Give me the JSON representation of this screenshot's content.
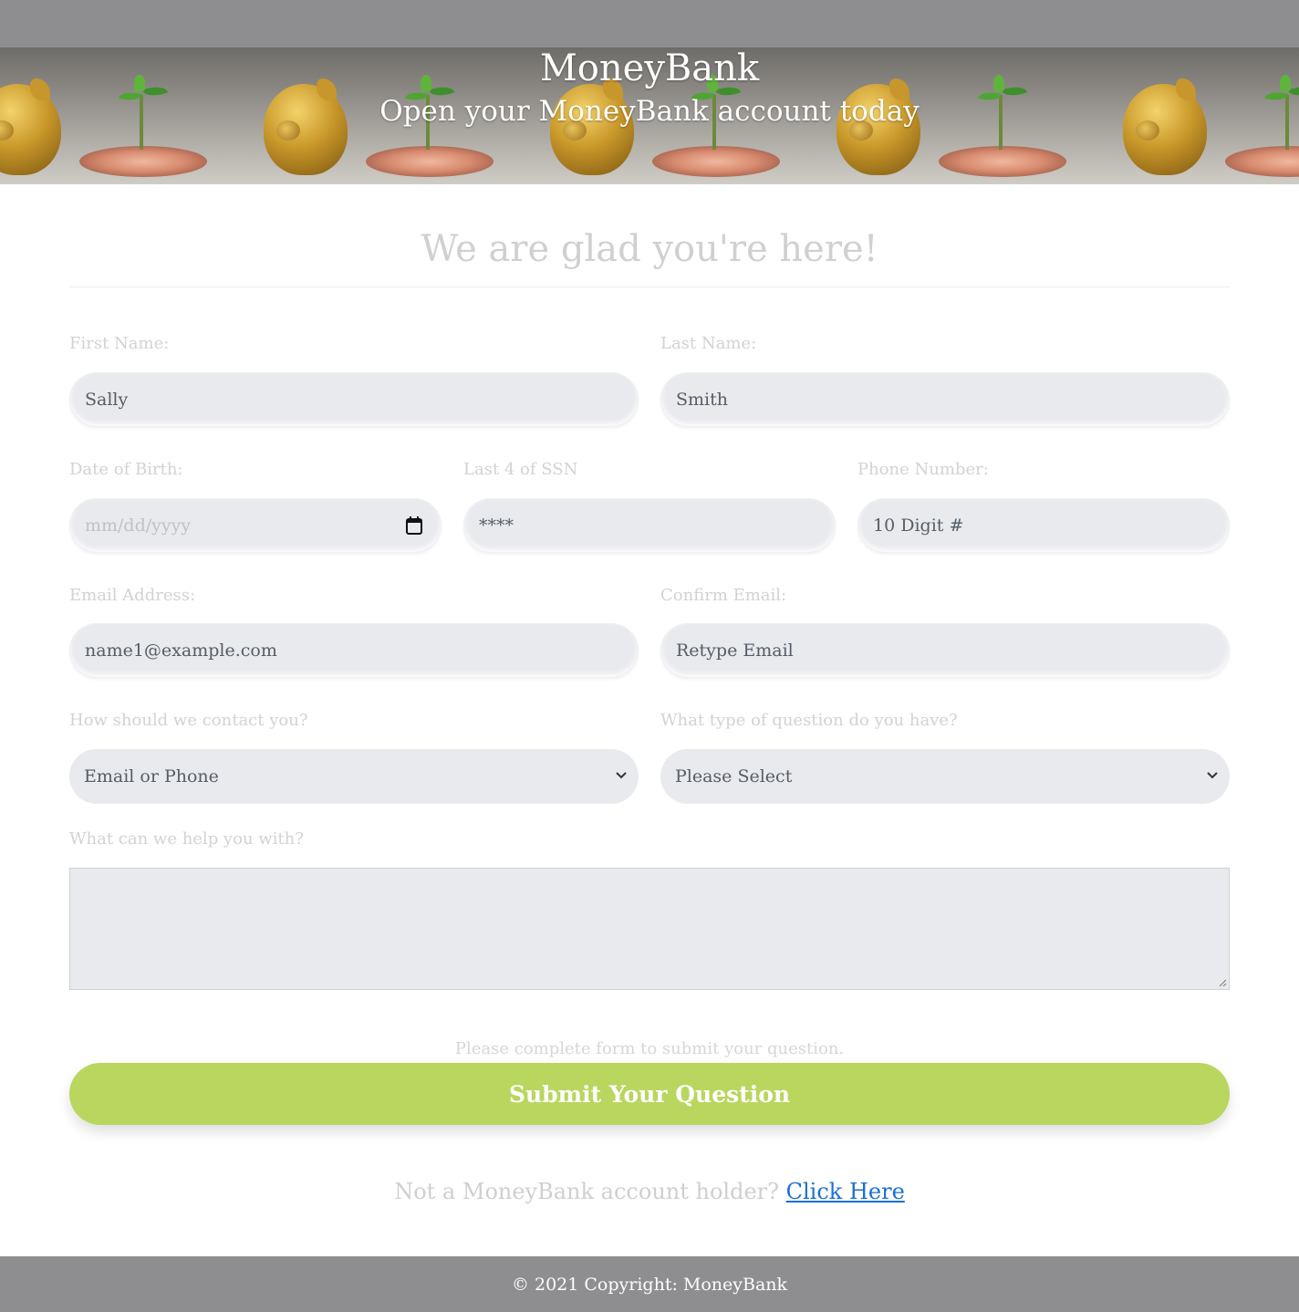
{
  "header": {
    "title": "MoneyBank",
    "subtitle": "Open your MoneyBank account today"
  },
  "main": {
    "heading": "We are glad you're here!",
    "form": {
      "first_name": {
        "label": "First Name:",
        "value": "Sally"
      },
      "last_name": {
        "label": "Last Name:",
        "value": "Smith"
      },
      "dob": {
        "label": "Date of Birth:",
        "placeholder": "mm/dd/yyyy"
      },
      "ssn": {
        "label": "Last 4 of SSN",
        "placeholder": "****"
      },
      "phone": {
        "label": "Phone Number:",
        "placeholder": "10 Digit #"
      },
      "email": {
        "label": "Email Address:",
        "value": "name1@example.com"
      },
      "confirm_email": {
        "label": "Confirm Email:",
        "value": "Retype Email"
      },
      "contact_method": {
        "label": "How should we contact you?",
        "selected": "Email or Phone"
      },
      "question_type": {
        "label": "What type of question do you have?",
        "selected": "Please Select"
      },
      "help": {
        "label": "What can we help you with?",
        "value": ""
      }
    },
    "notice": "Please complete form to submit your question.",
    "submit_label": "Submit Your Question",
    "not_holder_text": "Not a MoneyBank account holder?",
    "click_here": "Click Here"
  },
  "footer": {
    "copyright": "© 2021 Copyright: MoneyBank"
  },
  "colors": {
    "bar_gray": "#8e8e90",
    "submit_green": "#b9d65e",
    "field_bg": "#e9eaee",
    "link_blue": "#1a6fd6"
  },
  "icons": {
    "date": "calendar-icon",
    "select": "chevron-down-icon",
    "banner_images": [
      "piggy-bank-image",
      "coins-image",
      "sprout-image"
    ]
  }
}
